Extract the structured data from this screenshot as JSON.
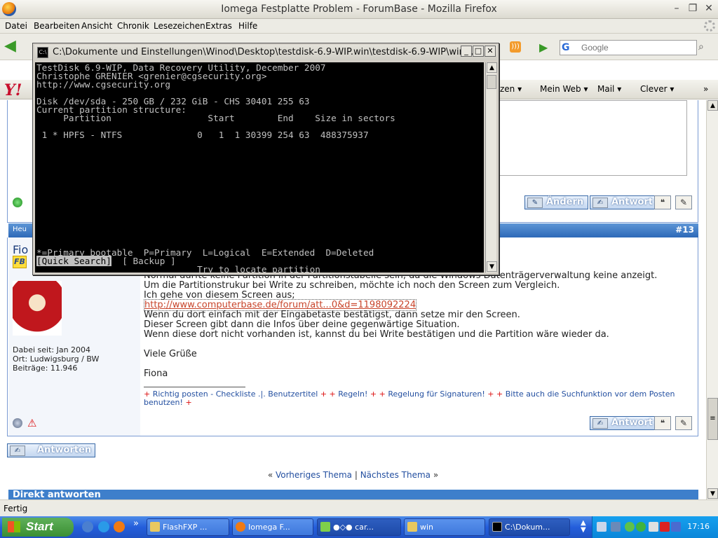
{
  "window": {
    "title": "Iomega Festplatte Problem - ForumBase - Mozilla Firefox"
  },
  "menubar": [
    "Datei",
    "Bearbeiten",
    "Ansicht",
    "Chronik",
    "Lesezeichen",
    "Extras",
    "Hilfe"
  ],
  "search": {
    "placeholder": "Google"
  },
  "yahoo": {
    "items": [
      "zen ▾",
      "Mein Web ▾",
      "Mail ▾",
      "Clever ▾",
      "»"
    ]
  },
  "forum": {
    "buttons_top": {
      "edit": "Ändern",
      "reply": "Antwort"
    },
    "post_head": {
      "left": "Heu",
      "number": "#13"
    },
    "post_name": "Fio",
    "fb_logo": "FB",
    "user_meta": [
      "Dabei seit: Jan 2004",
      "Ort: Ludwigsburg / BW",
      "Beiträge: 11.946"
    ],
    "text_lines": [
      "Normal dürfte keine Partition in der Partitionstabelle sein, da die Windows Datenträgerverwaltung keine anzeigt.",
      "Um die Partitionstrukur bei Write zu schreiben, möchte ich noch den Screen zum Vergleich.",
      "Ich gehe von diesem Screen aus;"
    ],
    "link": "http://www.computerbase.de/forum/att...0&d=1198092224",
    "text_lines2": [
      "Wenn du dort einfach mit der Eingabetaste bestätigst, dann setze mir den Screen.",
      "Dieser Screen gibt dann die Infos über deine gegenwärtige Situation.",
      "Wenn diese dort nicht vorhanden ist, kannst du bei Write bestätigen und die Partition wäre wieder da."
    ],
    "greeting": "Viele Grüße",
    "signature_name": "Fiona",
    "sig_links": [
      "Richtig posten - Checkliste .|. Benutzertitel",
      "Regeln!",
      "Regelung für Signaturen!",
      "Bitte auch die Suchfunktion vor dem Posten benutzen!"
    ],
    "reply_button": "Antwort",
    "answer_button": "Antworten",
    "nav": {
      "prev": "Vorheriges Thema",
      "sep": "|",
      "next": "Nächstes Thema"
    },
    "quick_reply": "Direkt antworten"
  },
  "status": "Fertig",
  "taskbar": {
    "start": "Start",
    "tasks": [
      "FlashFXP ...",
      "Iomega F...",
      "●◇● car...",
      "win",
      "C:\\Dokum..."
    ],
    "clock": "17:16"
  },
  "cmd": {
    "title": "C:\\Dokumente und Einstellungen\\Winod\\Desktop\\testdisk-6.9-WIP.win\\testdisk-6.9-WIP\\win...",
    "lines": [
      "TestDisk 6.9-WIP, Data Recovery Utility, December 2007",
      "Christophe GRENIER <grenier@cgsecurity.org>",
      "http://www.cgsecurity.org",
      "",
      "Disk /dev/sda - 250 GB / 232 GiB - CHS 30401 255 63",
      "Current partition structure:",
      "     Partition                  Start        End    Size in sectors",
      "",
      " 1 * HPFS - NTFS              0   1  1 30399 254 63  488375937"
    ],
    "legend": "*=Primary bootable  P=Primary  L=Logical  E=Extended  D=Deleted",
    "quick_search": "[Quick Search]",
    "backup": "  [ Backup ]",
    "hint": "                              Try to locate partition"
  }
}
